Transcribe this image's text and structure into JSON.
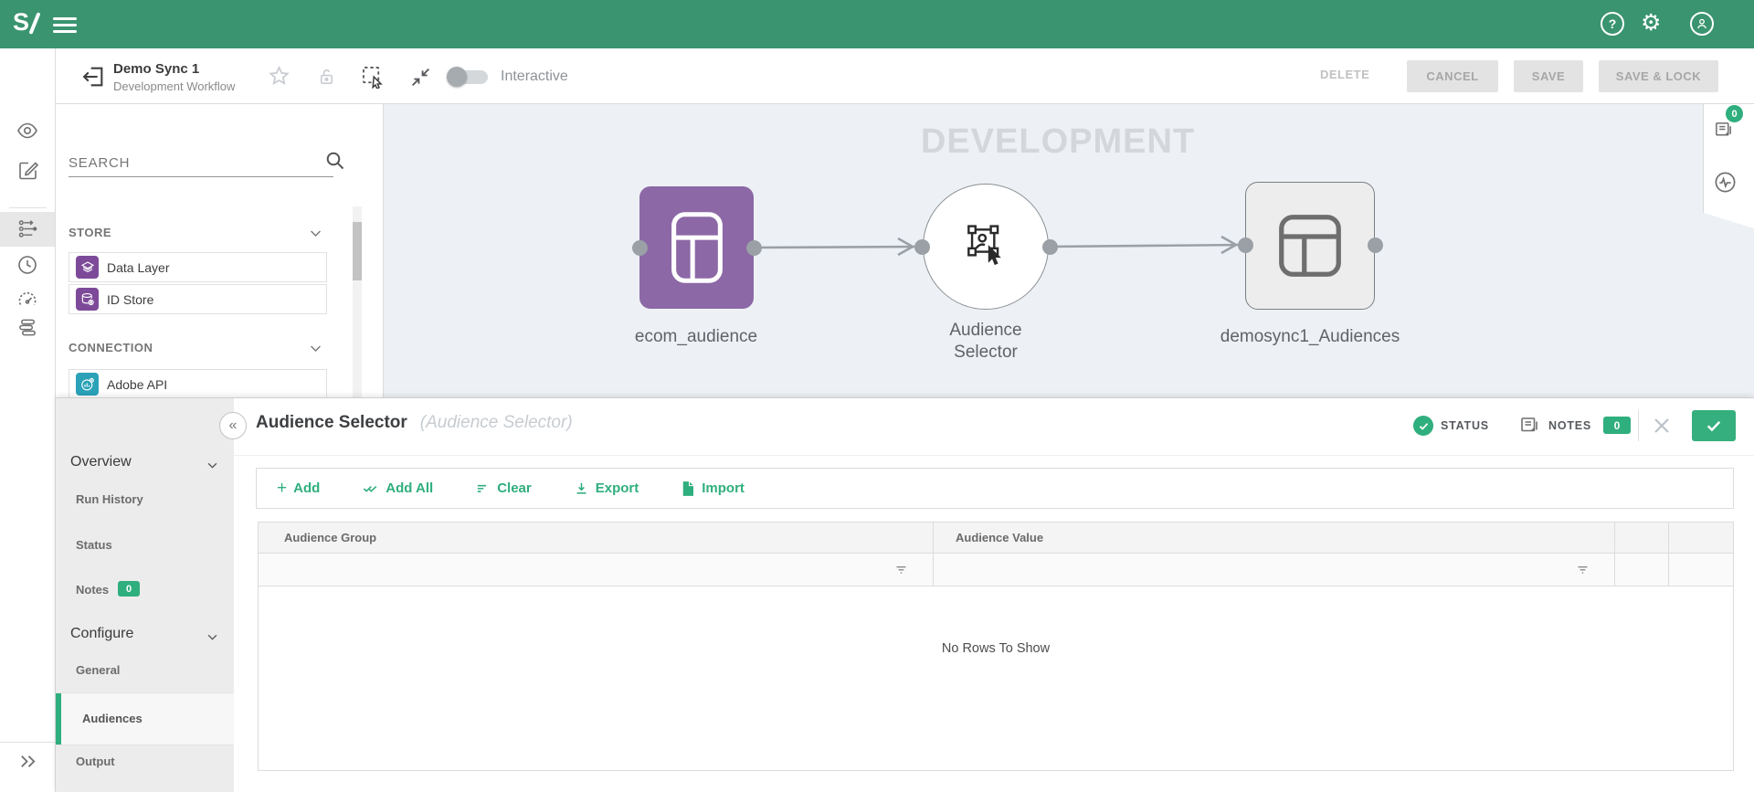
{
  "topbar": {
    "logo": "S"
  },
  "icons": {
    "help": "?",
    "gear": "⚙",
    "collapse_panel": "«",
    "plus": "+"
  },
  "toolbar": {
    "title": "Demo Sync 1",
    "subtitle": "Development Workflow",
    "interactive_label": "Interactive",
    "delete_label": "DELETE",
    "cancel_label": "CANCEL",
    "save_label": "SAVE",
    "save_lock_label": "SAVE & LOCK"
  },
  "palette": {
    "search_placeholder": "SEARCH",
    "store_label": "STORE",
    "connection_label": "CONNECTION",
    "store_items": [
      {
        "label": "Data Layer"
      },
      {
        "label": "ID Store"
      }
    ],
    "connection_items": [
      {
        "label": "Adobe API"
      }
    ]
  },
  "canvas": {
    "watermark": "DEVELOPMENT",
    "nodes": [
      {
        "label": "ecom_audience",
        "type": "source-table",
        "color": "#8C68A6"
      },
      {
        "label": "Audience Selector",
        "type": "audience-selector"
      },
      {
        "label": "demosync1_Audiences",
        "type": "target-table",
        "color": "#ededed"
      }
    ]
  },
  "right_rail": {
    "notes_badge": "0"
  },
  "panel": {
    "title": "Audience Selector",
    "subtitle": "(Audience Selector)",
    "status_label": "STATUS",
    "notes_label": "NOTES",
    "notes_badge": "0",
    "nav": {
      "overview": "Overview",
      "run_history": "Run History",
      "status": "Status",
      "notes": "Notes",
      "notes_badge": "0",
      "configure": "Configure",
      "general": "General",
      "audiences": "Audiences",
      "output": "Output"
    },
    "actions": {
      "add": "Add",
      "add_all": "Add All",
      "clear": "Clear",
      "export": "Export",
      "import": "Import"
    },
    "table": {
      "col1": "Audience Group",
      "col2": "Audience Value",
      "empty": "No Rows To Show"
    }
  },
  "colors": {
    "topbar": "#3A9470",
    "accent": "#2FAE7E",
    "canvas_bg": "#EDF1F5",
    "node_purple": "#8C68A6",
    "palette_purple": "#7D4A99",
    "teal": "#2BA2B8"
  }
}
